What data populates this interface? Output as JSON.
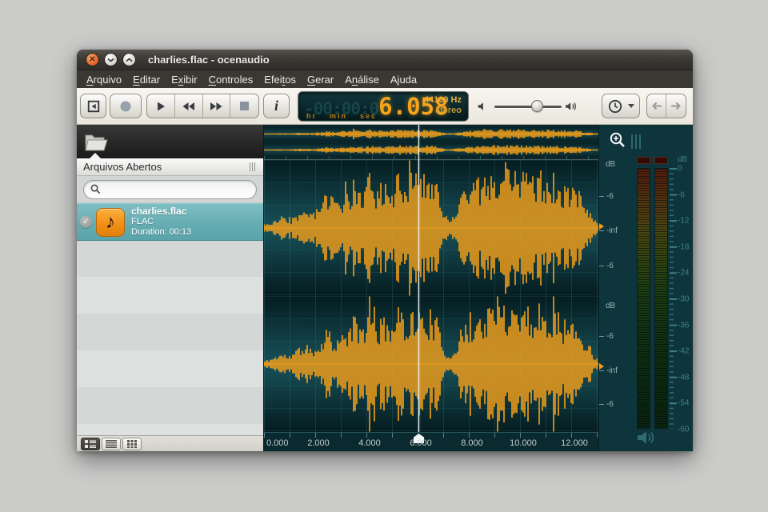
{
  "window": {
    "title": "charlies.flac - ocenaudio"
  },
  "menu": {
    "items": [
      {
        "label": "Arquivo",
        "accel": 0
      },
      {
        "label": "Editar",
        "accel": 0
      },
      {
        "label": "Exibir",
        "accel": 1
      },
      {
        "label": "Controles",
        "accel": 0
      },
      {
        "label": "Efeitos",
        "accel": 4
      },
      {
        "label": "Gerar",
        "accel": 0
      },
      {
        "label": "Análise",
        "accel": 1
      },
      {
        "label": "Ajuda",
        "accel": -1
      }
    ]
  },
  "time_display": {
    "ghost": "-00:00:0",
    "value": "6.058",
    "unit_hr": "hr",
    "unit_min": "min",
    "unit_sec": "sec",
    "sample_rate": "44100 Hz",
    "channels": "stereo"
  },
  "sidebar": {
    "panel_title": "Arquivos Abertos",
    "search_placeholder": "",
    "search_value": "",
    "file": {
      "name": "charlies.flac",
      "format": "FLAC",
      "duration": "Duration: 00:13"
    }
  },
  "timeline": {
    "labels": [
      "0.000",
      "2.000",
      "4.000",
      "6.000",
      "8.000",
      "10.000",
      "12.000"
    ],
    "seconds_per_label": 2
  },
  "wave": {
    "scale_labels": [
      "dB",
      "-6",
      "-inf",
      "-6"
    ],
    "playhead_fraction": 0.462,
    "seeds": [
      3,
      11
    ],
    "overview_seeds": [
      21,
      29
    ],
    "envelope": [
      [
        0,
        0.04
      ],
      [
        0.02,
        0.07
      ],
      [
        0.05,
        0.14
      ],
      [
        0.08,
        0.11
      ],
      [
        0.11,
        0.24
      ],
      [
        0.14,
        0.19
      ],
      [
        0.17,
        0.3
      ],
      [
        0.195,
        0.55
      ],
      [
        0.21,
        0.32
      ],
      [
        0.24,
        0.4
      ],
      [
        0.27,
        0.62
      ],
      [
        0.295,
        0.5
      ],
      [
        0.32,
        0.74
      ],
      [
        0.34,
        0.52
      ],
      [
        0.365,
        0.64
      ],
      [
        0.39,
        0.6
      ],
      [
        0.41,
        0.8
      ],
      [
        0.43,
        0.63
      ],
      [
        0.45,
        0.76
      ],
      [
        0.47,
        0.66
      ],
      [
        0.49,
        0.73
      ],
      [
        0.515,
        0.62
      ],
      [
        0.535,
        0.25
      ],
      [
        0.55,
        0.11
      ],
      [
        0.57,
        0.2
      ],
      [
        0.59,
        0.45
      ],
      [
        0.62,
        0.58
      ],
      [
        0.65,
        0.66
      ],
      [
        0.68,
        0.76
      ],
      [
        0.71,
        0.88
      ],
      [
        0.74,
        0.8
      ],
      [
        0.77,
        0.86
      ],
      [
        0.8,
        0.72
      ],
      [
        0.83,
        0.66
      ],
      [
        0.86,
        0.74
      ],
      [
        0.89,
        0.6
      ],
      [
        0.92,
        0.56
      ],
      [
        0.945,
        0.46
      ],
      [
        0.97,
        0.28
      ],
      [
        0.99,
        0.1
      ],
      [
        1,
        0.05
      ]
    ]
  },
  "meters": {
    "header": "dB",
    "scale": [
      "0",
      "-6",
      "-12",
      "-18",
      "-24",
      "-30",
      "-36",
      "-42",
      "-48",
      "-54",
      "-60"
    ]
  },
  "colors": {
    "wave": "#f6a019",
    "accent": "#f7a41d",
    "selection": "#64acb2",
    "titlebar": "#3a3833",
    "display_bg": "#082226",
    "meter_text": "#41808a"
  }
}
